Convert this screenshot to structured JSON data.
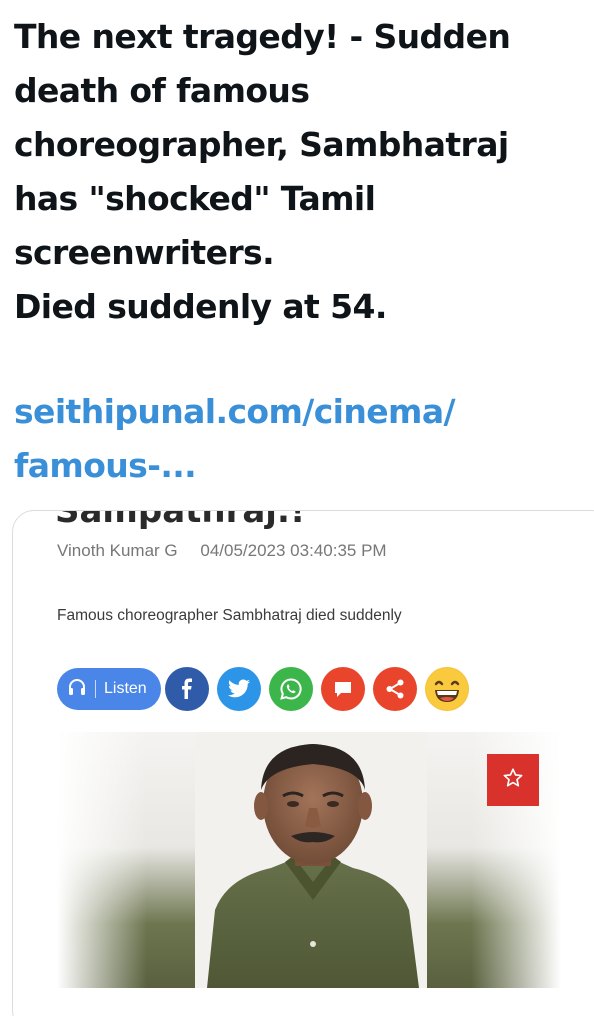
{
  "post": {
    "text_lines": [
      "The next tragedy! - Sudden",
      "death of famous",
      "choreographer, Sambhatraj",
      "has \"shocked\" Tamil",
      "screenwriters.",
      "Died suddenly at 54."
    ],
    "link_lines": [
      "seithipunal.com/cinema/",
      "famous-..."
    ]
  },
  "card": {
    "cut_title": "Sampathraj.!",
    "author": "Vinoth Kumar G",
    "datetime": "04/05/2023 03:40:35 PM",
    "summary": "Famous choreographer Sambhatraj died suddenly",
    "share": {
      "listen_label": "Listen",
      "buttons": [
        {
          "name": "facebook-icon",
          "color": "#2f5ba8"
        },
        {
          "name": "twitter-icon",
          "color": "#2c95e8"
        },
        {
          "name": "whatsapp-icon",
          "color": "#3cb54a"
        },
        {
          "name": "comment-icon",
          "color": "#e8452c"
        },
        {
          "name": "share-icon",
          "color": "#e8452c"
        },
        {
          "name": "laughing-emoji-icon",
          "color": "#f7c23c"
        }
      ]
    },
    "photo": {
      "description_icon": "portrait-photo",
      "favorite_icon": "star-icon",
      "favorite_color": "#d9322c"
    }
  },
  "colors": {
    "text": "#0f1419",
    "link": "#3a8fd9",
    "listen_bg": "#4a86e8"
  }
}
